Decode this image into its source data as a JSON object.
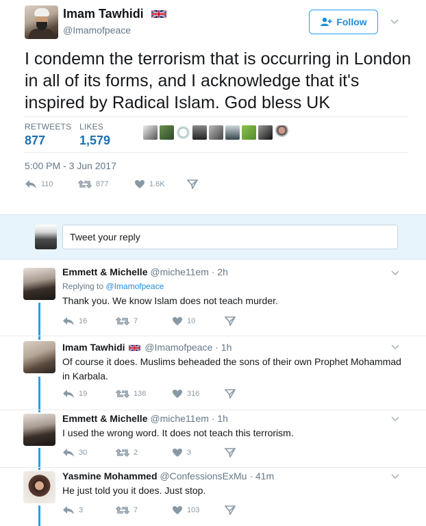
{
  "main_tweet": {
    "display_name": "Imam Tawhidi",
    "handle": "@Imamofpeace",
    "follow_label": "Follow",
    "text": "I condemn the terrorism that is occurring in London in all of its forms, and I acknowledge that it's inspired by Radical Islam. God bless UK",
    "retweets_label": "RETWEETS",
    "retweets_value": "877",
    "likes_label": "LIKES",
    "likes_value": "1,579",
    "timestamp": "5:00 PM - 3 Jun 2017",
    "actions": {
      "replies": "110",
      "retweets": "877",
      "likes": "1.6K"
    }
  },
  "reply_box": {
    "placeholder": "Tweet your reply"
  },
  "replies": [
    {
      "name": "Emmett & Michelle",
      "meta": "@miche11em · 2h",
      "replying_prefix": "Replying to",
      "replying_handle": "@Imamofpeace",
      "text": "Thank you. We know Islam does not teach murder.",
      "actions": {
        "replies": "16",
        "retweets": "7",
        "likes": "10"
      }
    },
    {
      "name": "Imam Tawhidi",
      "meta": "@Imamofpeace · 1h",
      "text_line1": "Of course it does. Muslims beheaded the sons of their own Prophet Mohammad",
      "text_line2": "in Karbala.",
      "actions": {
        "replies": "19",
        "retweets": "136",
        "likes": "316"
      }
    },
    {
      "name": "Emmett & Michelle",
      "meta": "@miche11em · 1h",
      "text": "I used the wrong word. It does not teach this terrorism.",
      "actions": {
        "replies": "30",
        "retweets": "2",
        "likes": "3"
      }
    },
    {
      "name": "Yasmine Mohammed",
      "meta": "@ConfessionsExMu · 41m",
      "text": "He just told you it does. Just stop.",
      "actions": {
        "replies": "3",
        "retweets": "7",
        "likes": "103"
      }
    }
  ],
  "colors": {
    "accent": "#1da1f2",
    "link": "#1d8cd8",
    "muted": "#657786",
    "icon": "#8899a6"
  }
}
